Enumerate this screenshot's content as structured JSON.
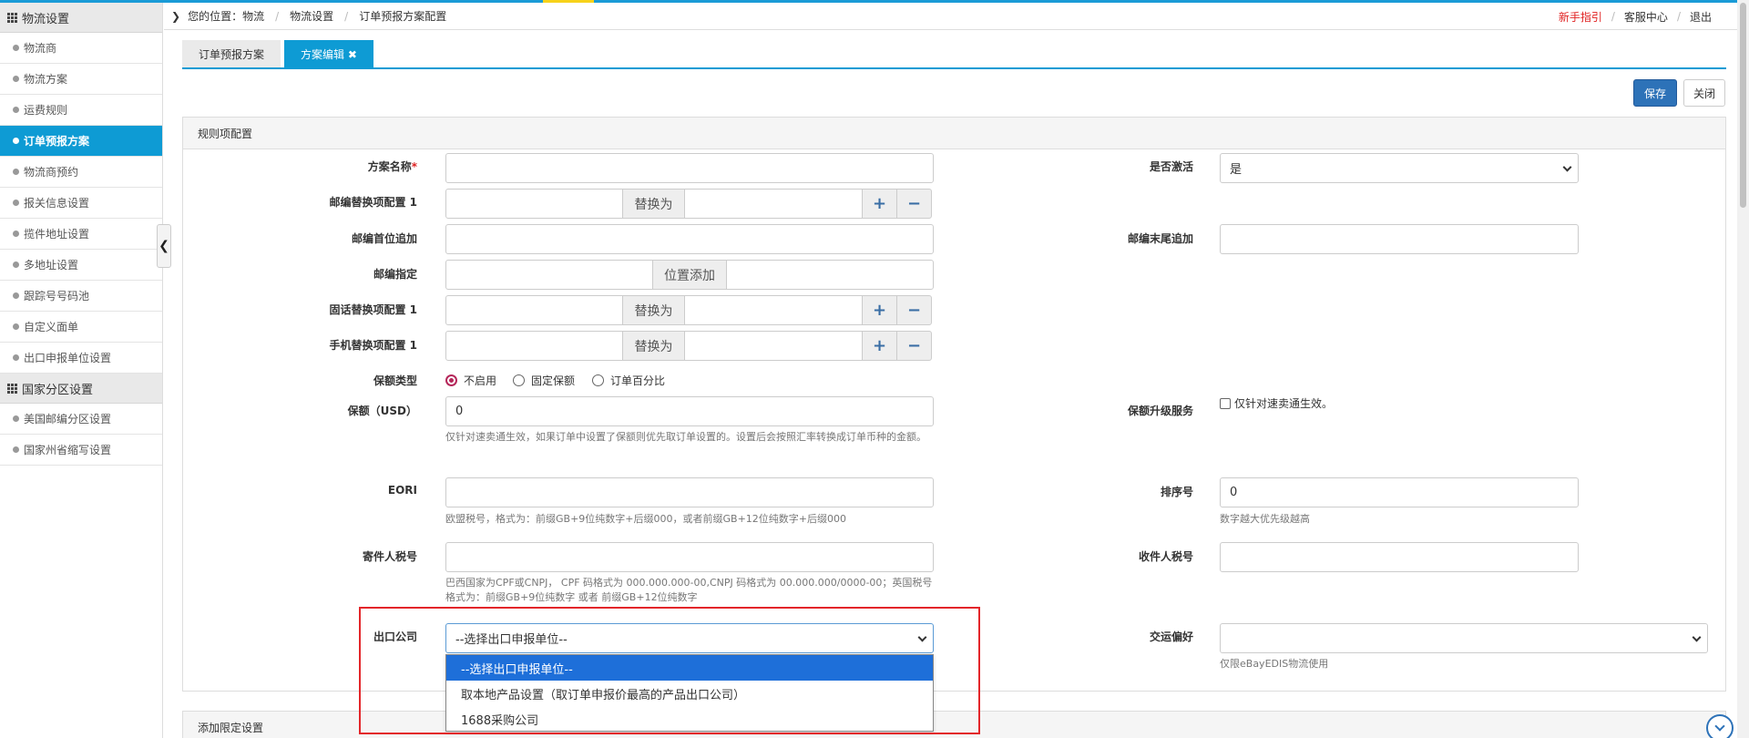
{
  "breadcrumb": {
    "prefix": "您的位置：",
    "items": [
      "物流",
      "物流设置",
      "订单预报方案配置"
    ]
  },
  "top_links": {
    "new_guide": "新手指引",
    "service": "客服中心",
    "logout": "退出"
  },
  "sidebar": {
    "group1": "物流设置",
    "items1": [
      "物流商",
      "物流方案",
      "运费规则",
      "订单预报方案",
      "物流商预约",
      "报关信息设置",
      "揽件地址设置",
      "多地址设置",
      "跟踪号号码池",
      "自定义面单",
      "出口申报单位设置"
    ],
    "active_index": 3,
    "group2": "国家分区设置",
    "items2": [
      "美国邮编分区设置",
      "国家州省缩写设置"
    ]
  },
  "tabs": {
    "tab1": "订单预报方案",
    "tab2": "方案编辑 ✖"
  },
  "actions": {
    "save": "保存",
    "close": "关闭"
  },
  "panel": {
    "title": "规则项配置",
    "second_title": "添加限定设置"
  },
  "form": {
    "plan_name_label": "方案名称",
    "required_mark": "*",
    "active_label": "是否激活",
    "active_value": "是",
    "zip_replace_label": "邮编替换项配置 1",
    "replace_with": "替换为",
    "plus": "+",
    "minus": "−",
    "zip_prefix_label": "邮编首位追加",
    "zip_suffix_label": "邮编末尾追加",
    "zip_assign_label": "邮编指定",
    "position_add": "位置添加",
    "phone_replace_label": "固话替换项配置 1",
    "mobile_replace_label": "手机替换项配置 1",
    "insurance_type_label": "保额类型",
    "insurance_options": [
      "不启用",
      "固定保额",
      "订单百分比"
    ],
    "insurance_label": "保额（USD）",
    "insurance_value": "0",
    "insurance_help": "仅针对速卖通生效，如果订单中设置了保额则优先取订单设置的。设置后会按照汇率转换成订单币种的金额。",
    "insurance_upgrade_label": "保额升级服务",
    "insurance_upgrade_text": "仅针对速卖通生效。",
    "eori_label": "EORI",
    "eori_help": "欧盟税号，格式为：前缀GB+9位纯数字+后缀000，或者前缀GB+12位纯数字+后缀000",
    "sort_label": "排序号",
    "sort_value": "0",
    "sort_help": "数字越大优先级越高",
    "sender_tax_label": "寄件人税号",
    "sender_tax_help": "巴西国家为CPF或CNPJ， CPF 码格式为 000.000.000-00,CNPJ 码格式为 00.000.000/0000-00；英国税号格式为：前缀GB+9位纯数字 或者 前缀GB+12位纯数字",
    "receiver_tax_label": "收件人税号",
    "export_company_label": "出口公司",
    "export_company_value": "--选择出口申报单位--",
    "handover_label": "交运偏好",
    "handover_help": "仅限eBayEDIS物流使用"
  },
  "dropdown_options": [
    "--选择出口申报单位--",
    "取本地产品设置（取订单申报价最高的产品出口公司）",
    "1688采购公司"
  ],
  "colors": {
    "accent": "#0e9bd4",
    "save_button": "#2d72b8",
    "highlight_border": "#e3262a",
    "selected_option": "#1e6fd9",
    "new_guide_link": "#e02020"
  }
}
